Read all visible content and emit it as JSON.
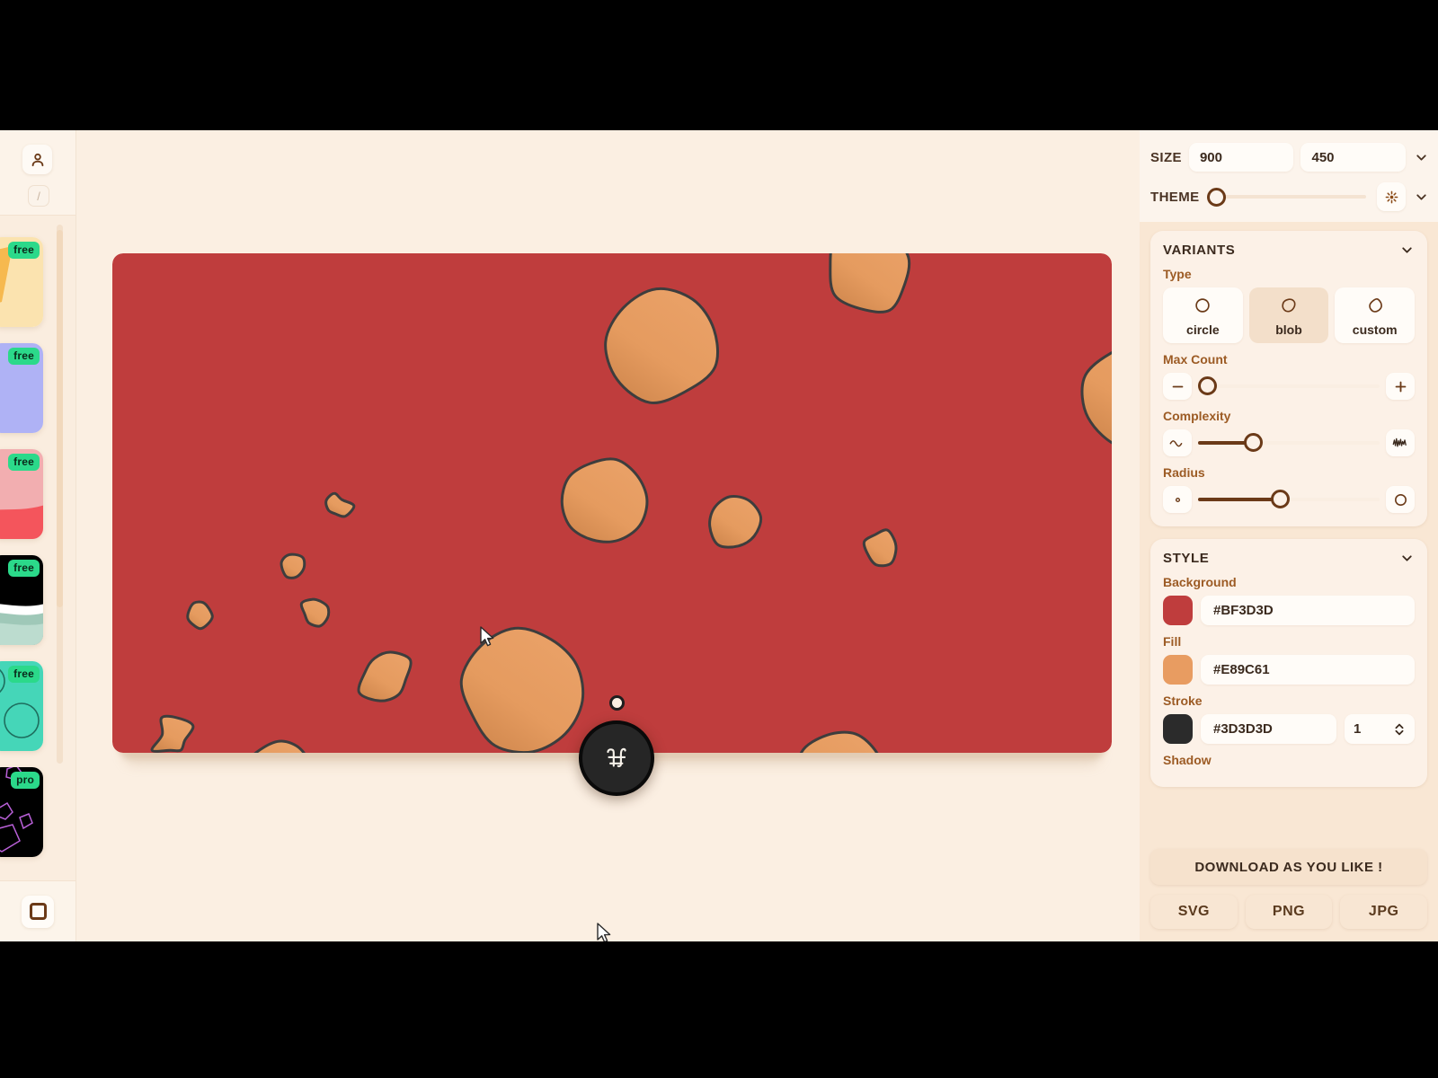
{
  "sidebar": {
    "avatar_icon": "user-icon",
    "shortcut_badge": "/",
    "bottom_icon": "square-icon",
    "thumbnails": [
      {
        "badge": "free",
        "name": "template-yellow",
        "bg": "#FBE3AF",
        "shape": "#F6B94F"
      },
      {
        "badge": "free",
        "name": "template-periwinkle",
        "bg": "#AFB2F5",
        "shape": "#5A63E8"
      },
      {
        "badge": "free",
        "name": "template-pink",
        "bg": "#F2AEB0",
        "shape": "#F4555C"
      },
      {
        "badge": "free",
        "name": "template-black-wave",
        "bg": "#000000",
        "shape": "#9FC8B8"
      },
      {
        "badge": "free",
        "name": "template-mint-circles",
        "bg": "#45D6B8",
        "shape": "#2FB89C"
      },
      {
        "badge": "pro",
        "name": "template-dark-outline",
        "bg": "#000000",
        "shape": "#B960D8"
      }
    ]
  },
  "canvas": {
    "background_color": "#BF3D3D",
    "fill_color": "#E89C61",
    "stroke_color": "#3D3D3D",
    "fab_icon": "blob-generator-icon",
    "anchor_handle": "resize-handle"
  },
  "panel": {
    "size_label": "SIZE",
    "size_width": "900",
    "size_height": "450",
    "theme_label": "THEME",
    "theme_icon": "sun-icon",
    "variants": {
      "title": "VARIANTS",
      "type_label": "Type",
      "types": [
        {
          "label": "circle",
          "icon": "circle-icon",
          "active": false
        },
        {
          "label": "blob",
          "icon": "blob-icon",
          "active": true
        },
        {
          "label": "custom",
          "icon": "custom-shape-icon",
          "active": false
        }
      ],
      "max_count_label": "Max Count",
      "max_count_pct": 3,
      "complexity_label": "Complexity",
      "complexity_pct": 30,
      "radius_label": "Radius",
      "radius_pct": 45,
      "minus_icon": "minus-icon",
      "plus_icon": "plus-icon",
      "wave_low_icon": "wave-low-icon",
      "wave_high_icon": "wave-high-icon",
      "dot_small_icon": "small-circle-icon",
      "dot_large_icon": "large-circle-icon"
    },
    "style": {
      "title": "STYLE",
      "background_label": "Background",
      "background_value": "#BF3D3D",
      "fill_label": "Fill",
      "fill_value": "#E89C61",
      "stroke_label": "Stroke",
      "stroke_value": "#3D3D3D",
      "stroke_width": "1",
      "shadow_label": "Shadow"
    },
    "download": {
      "main_label": "DOWNLOAD AS YOU LIKE !",
      "formats": [
        "SVG",
        "PNG",
        "JPG"
      ]
    }
  }
}
